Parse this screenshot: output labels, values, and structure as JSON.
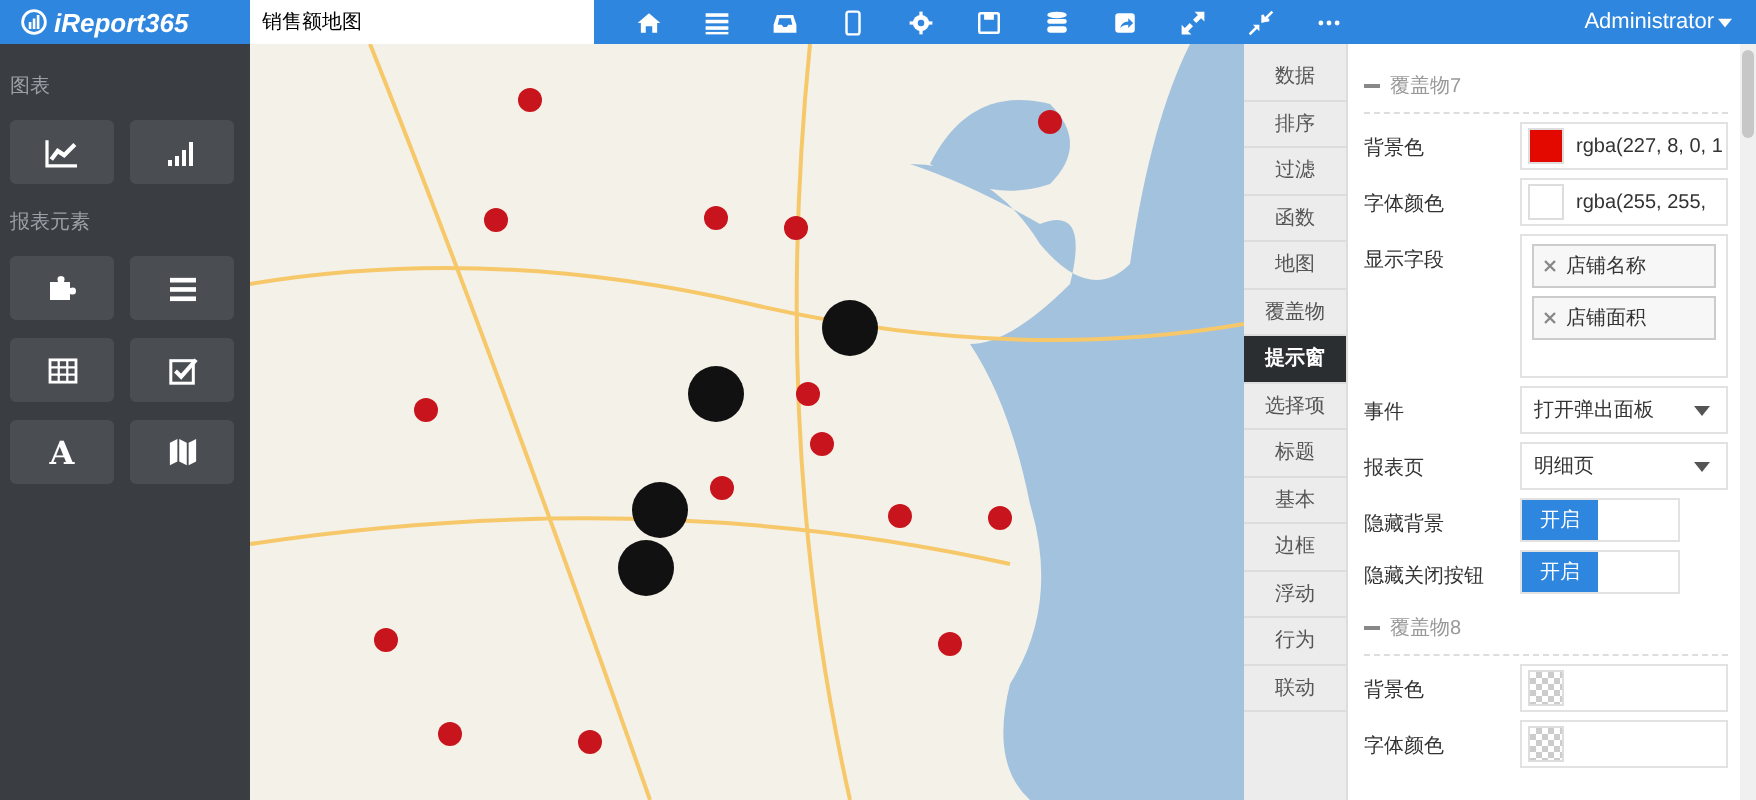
{
  "header": {
    "logo": "iReport365",
    "report_name": "销售额地图",
    "user": "Administrator"
  },
  "sidebar": {
    "sections": [
      {
        "title": "图表",
        "items": [
          {
            "kind": "line-chart"
          },
          {
            "kind": "bar-chart"
          }
        ]
      },
      {
        "title": "报表元素",
        "items": [
          {
            "kind": "puzzle"
          },
          {
            "kind": "list"
          },
          {
            "kind": "table"
          },
          {
            "kind": "checkbox"
          },
          {
            "kind": "text",
            "glyph": "A"
          },
          {
            "kind": "map"
          }
        ]
      }
    ]
  },
  "tabs": [
    {
      "label": "数据",
      "selected": false
    },
    {
      "label": "排序",
      "selected": false
    },
    {
      "label": "过滤",
      "selected": false
    },
    {
      "label": "函数",
      "selected": false
    },
    {
      "label": "地图",
      "selected": false
    },
    {
      "label": "覆盖物",
      "selected": false
    },
    {
      "label": "提示窗",
      "selected": true
    },
    {
      "label": "选择项",
      "selected": false
    },
    {
      "label": "标题",
      "selected": false
    },
    {
      "label": "基本",
      "selected": false
    },
    {
      "label": "边框",
      "selected": false
    },
    {
      "label": "浮动",
      "selected": false
    },
    {
      "label": "行为",
      "selected": false
    },
    {
      "label": "联动",
      "selected": false
    }
  ],
  "panel": {
    "sections": [
      {
        "title": "覆盖物7",
        "expanded": true,
        "fields": [
          {
            "kind": "color",
            "label": "背景色",
            "color": "#e30800",
            "value": "rgba(227, 8, 0, 1"
          },
          {
            "kind": "color",
            "label": "字体颜色",
            "color": "#ffffff",
            "value": "rgba(255, 255,"
          },
          {
            "kind": "tags",
            "label": "显示字段",
            "tags": [
              "店铺名称",
              "店铺面积"
            ]
          },
          {
            "kind": "select",
            "label": "事件",
            "value": "打开弹出面板"
          },
          {
            "kind": "select",
            "label": "报表页",
            "value": "明细页"
          },
          {
            "kind": "toggle",
            "label": "隐藏背景",
            "on": true,
            "on_label": "开启"
          },
          {
            "kind": "toggle",
            "label": "隐藏关闭按钮",
            "on": true,
            "on_label": "开启"
          }
        ]
      },
      {
        "title": "覆盖物8",
        "expanded": true,
        "fields": [
          {
            "kind": "color",
            "label": "背景色"
          },
          {
            "kind": "color",
            "label": "字体颜色"
          }
        ]
      }
    ]
  }
}
